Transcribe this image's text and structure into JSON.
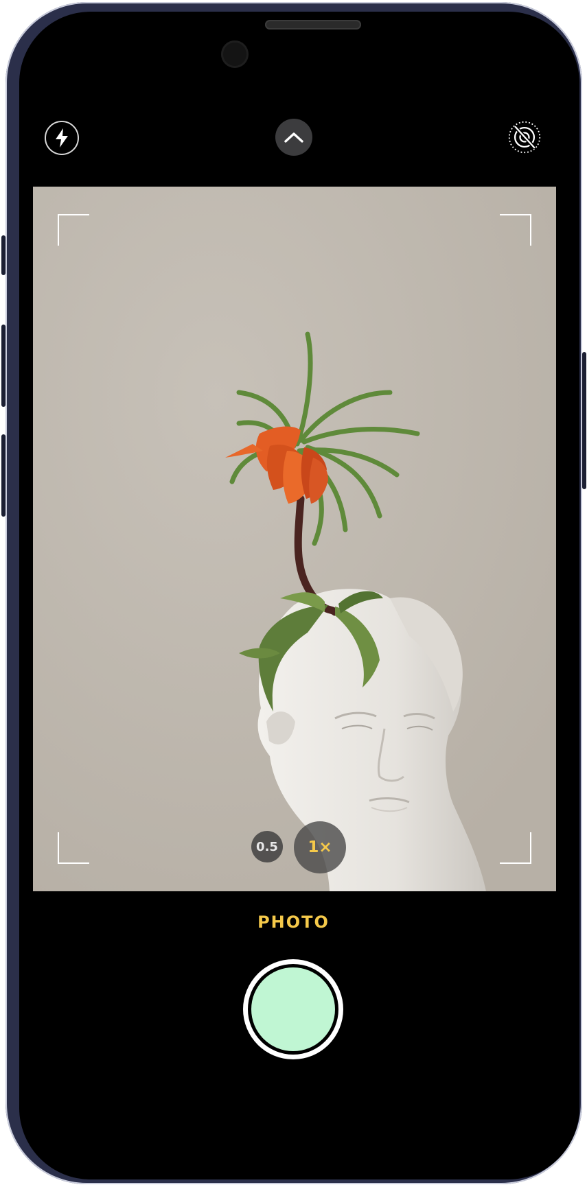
{
  "camera": {
    "mode_label": "PHOTO",
    "zoom": {
      "options": [
        "0.5",
        "1×"
      ],
      "selected": "1×"
    }
  },
  "icons": {
    "flash": "lightning-bolt-icon",
    "expand_controls": "chevron-up-icon",
    "live_photo": "live-photo-off-icon"
  },
  "colors": {
    "accent": "#f5c94a",
    "shutter": "#c0f6d3",
    "screen_background": "#000000",
    "frame": "#2b2f4a"
  }
}
